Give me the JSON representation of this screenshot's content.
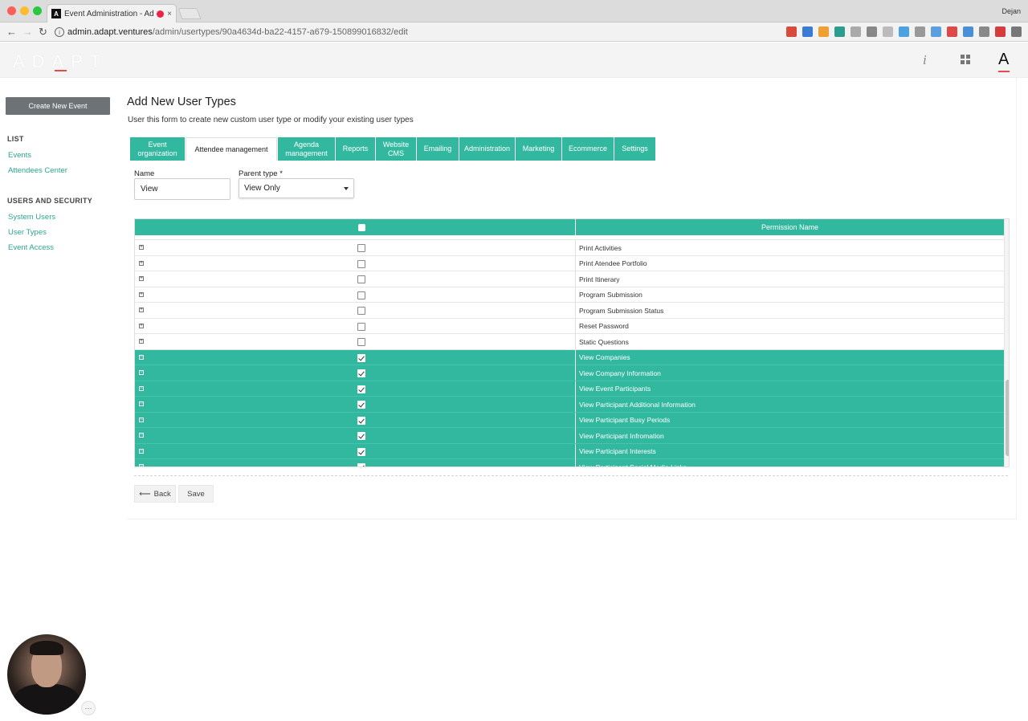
{
  "browser": {
    "tab_title": "Event Administration - Adap",
    "favicon_letter": "A",
    "profile_name": "Dejan",
    "url_host": "admin.adapt.ventures",
    "url_path": "/admin/usertypes/90a4634d-ba22-4157-a679-150899016832/edit",
    "extension_icons": [
      "#d94a3a",
      "#3a7bd5",
      "#f0a030",
      "#2a9d8f",
      "#aaaaaa",
      "#888888",
      "#bbbbbb",
      "#4aa3df",
      "#999999",
      "#5aa0e0",
      "#e04848",
      "#4a90d9",
      "#888888",
      "#d63c3c",
      "#777777"
    ]
  },
  "header": {
    "logo": "ADAPT",
    "info_icon": "i",
    "user_letter": "A"
  },
  "sidebar": {
    "create_button": "Create New Event",
    "list_heading": "LIST",
    "list_items": [
      "Events",
      "Attendees Center"
    ],
    "security_heading": "USERS AND SECURITY",
    "security_items": [
      "System Users",
      "User Types",
      "Event Access"
    ]
  },
  "main": {
    "title": "Add New User Types",
    "subtitle": "User this form to create new custom user type or modify your existing user types",
    "tabs": [
      {
        "label": "Event\norganization",
        "active": false,
        "width": 68
      },
      {
        "label": "Attendee management",
        "active": true,
        "width": 114
      },
      {
        "label": "Agenda\nmanagement",
        "active": false,
        "width": 71
      },
      {
        "label": "Reports",
        "active": false,
        "width": 49
      },
      {
        "label": "Website\nCMS",
        "active": false,
        "width": 50
      },
      {
        "label": "Emailing",
        "active": false,
        "width": 52
      },
      {
        "label": "Administration",
        "active": false,
        "width": 69
      },
      {
        "label": "Marketing",
        "active": false,
        "width": 57
      },
      {
        "label": "Ecommerce",
        "active": false,
        "width": 64
      },
      {
        "label": "Settings",
        "active": false,
        "width": 51
      }
    ],
    "name_label": "Name",
    "name_value": "View",
    "parent_label": "Parent type *",
    "parent_value": "View Only",
    "table_header": "Permission Name",
    "rows": [
      {
        "name": "Print Activities",
        "checked": false
      },
      {
        "name": "Print Atendee Portfolio",
        "checked": false
      },
      {
        "name": "Print Itinerary",
        "checked": false
      },
      {
        "name": "Program Submission",
        "checked": false
      },
      {
        "name": "Program Submission Status",
        "checked": false
      },
      {
        "name": "Reset Password",
        "checked": false
      },
      {
        "name": "Static Questions",
        "checked": false
      },
      {
        "name": "View Companies",
        "checked": true
      },
      {
        "name": "View Company Information",
        "checked": true
      },
      {
        "name": "View Event Participants",
        "checked": true
      },
      {
        "name": "View Participant Additional Information",
        "checked": true
      },
      {
        "name": "View Participant Busy Periods",
        "checked": true
      },
      {
        "name": "View Participant Infromation",
        "checked": true
      },
      {
        "name": "View Participant Interests",
        "checked": true
      },
      {
        "name": "View Participant Social Media Links",
        "checked": true
      }
    ],
    "back_label": "Back",
    "save_label": "Save"
  }
}
